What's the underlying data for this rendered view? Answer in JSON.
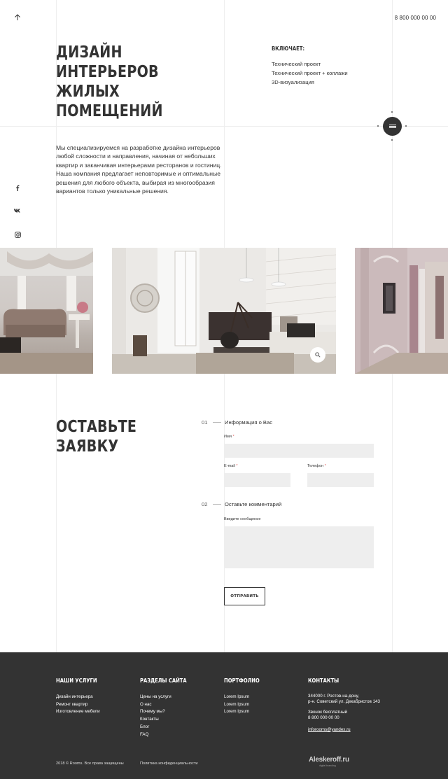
{
  "header": {
    "phone": "8 800 000 00 00"
  },
  "hero": {
    "title_lines": [
      "ДИЗАЙН",
      "ИНТЕРЬЕРОВ",
      "ЖИЛЫХ",
      "ПОМЕЩЕНИЙ"
    ],
    "description": "Мы специализируемся на разработке дизайна интерьеров любой сложности и направления, начиная от небольших квартир и заканчивая интерьерами ресторанов и гостиниц. Наша компания предлагает неповторимые и оптимальные решения для любого объекта, выбирая из многообразия вариантов только уникальные решения."
  },
  "includes": {
    "title": "ВКЛЮЧАЕТ:",
    "items": [
      "Технический проект",
      "Технический проект + коллажи",
      "3D-визуализация"
    ]
  },
  "social": [
    "facebook-icon",
    "vk-icon",
    "instagram-icon"
  ],
  "request": {
    "title_lines": [
      "ОСТАВЬТЕ",
      "ЗАЯВКУ"
    ],
    "step1": {
      "num": "01",
      "label": "Информация о Вас"
    },
    "step2": {
      "num": "02",
      "label": "Оставьте комментарий"
    },
    "name_label": "Имя",
    "email_label": "E-mail",
    "phone_label": "Телефон",
    "message_label": "Введите сообщение",
    "required_mark": "*",
    "submit_label": "ОТПРАВИТЬ"
  },
  "footer": {
    "services": {
      "title": "НАШИ УСЛУГИ",
      "items": [
        "Дизайн интерьера",
        "Ремонт квартир",
        "Изготовление мебели"
      ]
    },
    "sections": {
      "title": "РАЗДЕЛЫ САЙТА",
      "items": [
        "Цены на услуги",
        "О нас",
        "Почему мы?",
        "Контакты",
        "Блог",
        "FAQ"
      ]
    },
    "portfolio": {
      "title": "ПОРТФОЛИО",
      "items": [
        "Lorem Ipsum",
        "Lorem Ipsum",
        "Lorem Ipsum"
      ]
    },
    "contacts": {
      "title": "КОНТАКТЫ",
      "address_line1": "344000 г. Ростов-на-дону,",
      "address_line2": "р-н. Советский ул. Декабристов 143",
      "call_label": "Звонок бесплатный",
      "phone": "8 800 000 00 00",
      "email": "inforooms@yandex.ru"
    },
    "copyright": "2018 © Rooms. Все права защищены",
    "privacy": "Политика конфиденциальности",
    "brand": "Aleskeroff.ru",
    "brand_sub": "digital branding"
  },
  "colors": {
    "dark": "#333333",
    "field_bg": "#eeeeee",
    "required": "#e06060"
  }
}
